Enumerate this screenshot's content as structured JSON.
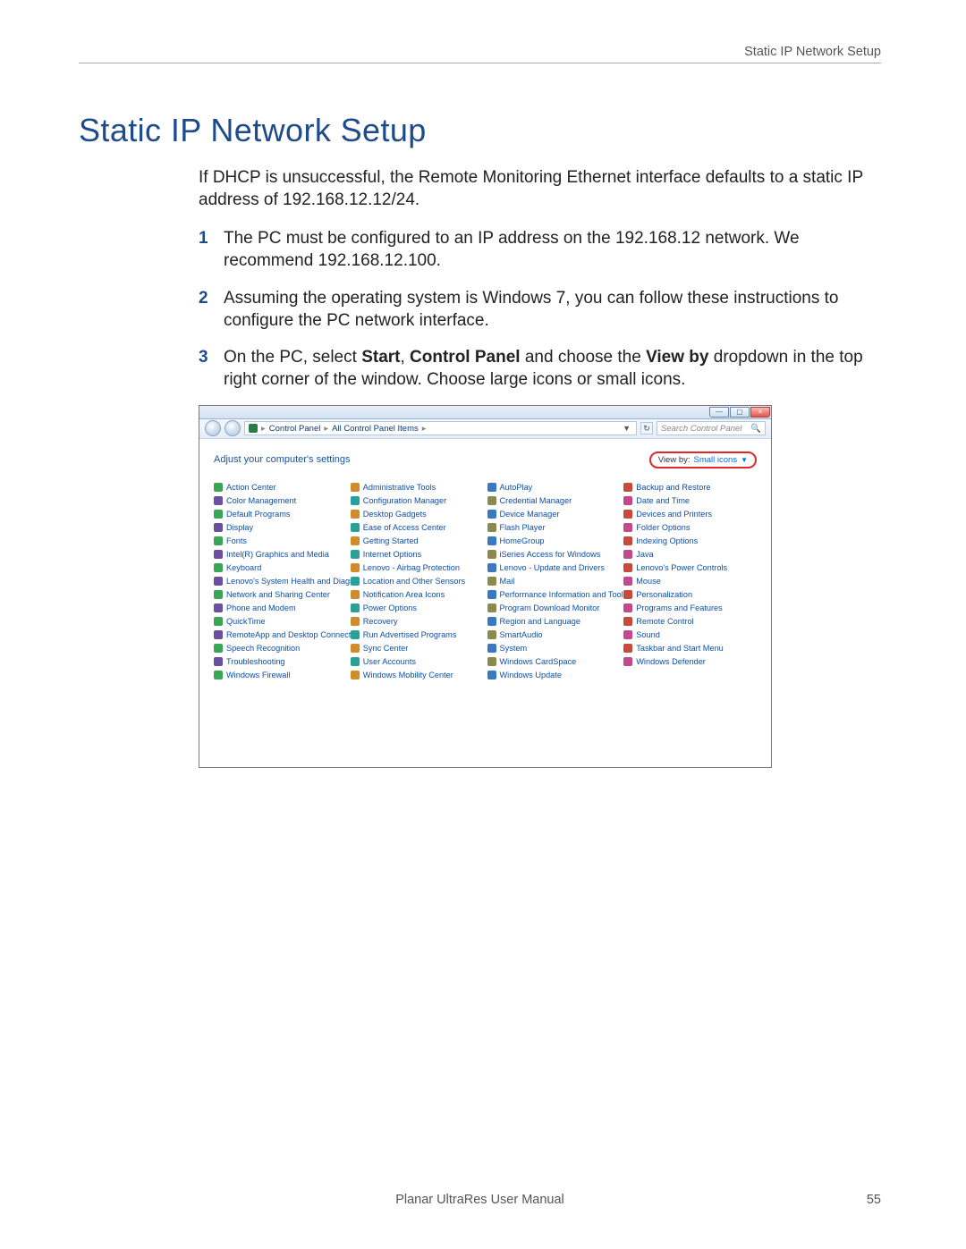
{
  "header": {
    "right_label": "Static IP Network Setup"
  },
  "h1": "Static IP Network Setup",
  "intro": "If DHCP is unsuccessful, the Remote Monitoring Ethernet interface defaults to a static IP address of 192.168.12.12/24.",
  "steps": [
    {
      "n": "1",
      "text": "The PC must be configured to an IP address on the 192.168.12 network. We recommend 192.168.12.100."
    },
    {
      "n": "2",
      "text": "Assuming the operating system is Windows 7, you can follow these instructions to configure the PC network interface."
    },
    {
      "n": "3",
      "pre": "On the PC, select ",
      "b1": "Start",
      "mid1": ", ",
      "b2": "Control Panel",
      "mid2": " and choose the ",
      "b3": "View by",
      "post": " dropdown in the top right corner of the window. Choose large icons or small icons."
    }
  ],
  "window": {
    "chrome": {
      "min": "—",
      "max": "▢",
      "close": "×"
    },
    "breadcrumb": {
      "seg1": "Control Panel",
      "seg2": "All Control Panel Items",
      "sep": "▸"
    },
    "search_placeholder": "Search Control Panel",
    "adjust_label": "Adjust your computer's settings",
    "viewby": {
      "label": "View by:",
      "value": "Small icons"
    }
  },
  "cp_items": [
    "Action Center",
    "Administrative Tools",
    "AutoPlay",
    "Backup and Restore",
    "Color Management",
    "Configuration Manager",
    "Credential Manager",
    "Date and Time",
    "Default Programs",
    "Desktop Gadgets",
    "Device Manager",
    "Devices and Printers",
    "Display",
    "Ease of Access Center",
    "Flash Player",
    "Folder Options",
    "Fonts",
    "Getting Started",
    "HomeGroup",
    "Indexing Options",
    "Intel(R) Graphics and Media",
    "Internet Options",
    "iSeries Access for Windows",
    "Java",
    "Keyboard",
    "Lenovo - Airbag Protection",
    "Lenovo - Update and Drivers",
    "Lenovo's Power Controls",
    "Lenovo's System Health and Diagno...",
    "Location and Other Sensors",
    "Mail",
    "Mouse",
    "Network and Sharing Center",
    "Notification Area Icons",
    "Performance Information and Tools",
    "Personalization",
    "Phone and Modem",
    "Power Options",
    "Program Download Monitor",
    "Programs and Features",
    "QuickTime",
    "Recovery",
    "Region and Language",
    "Remote Control",
    "RemoteApp and Desktop Connections",
    "Run Advertised Programs",
    "SmartAudio",
    "Sound",
    "Speech Recognition",
    "Sync Center",
    "System",
    "Taskbar and Start Menu",
    "Troubleshooting",
    "User Accounts",
    "Windows CardSpace",
    "Windows Defender",
    "Windows Firewall",
    "Windows Mobility Center",
    "Windows Update"
  ],
  "footer": {
    "center": "Planar UltraRes User Manual",
    "page": "55"
  }
}
